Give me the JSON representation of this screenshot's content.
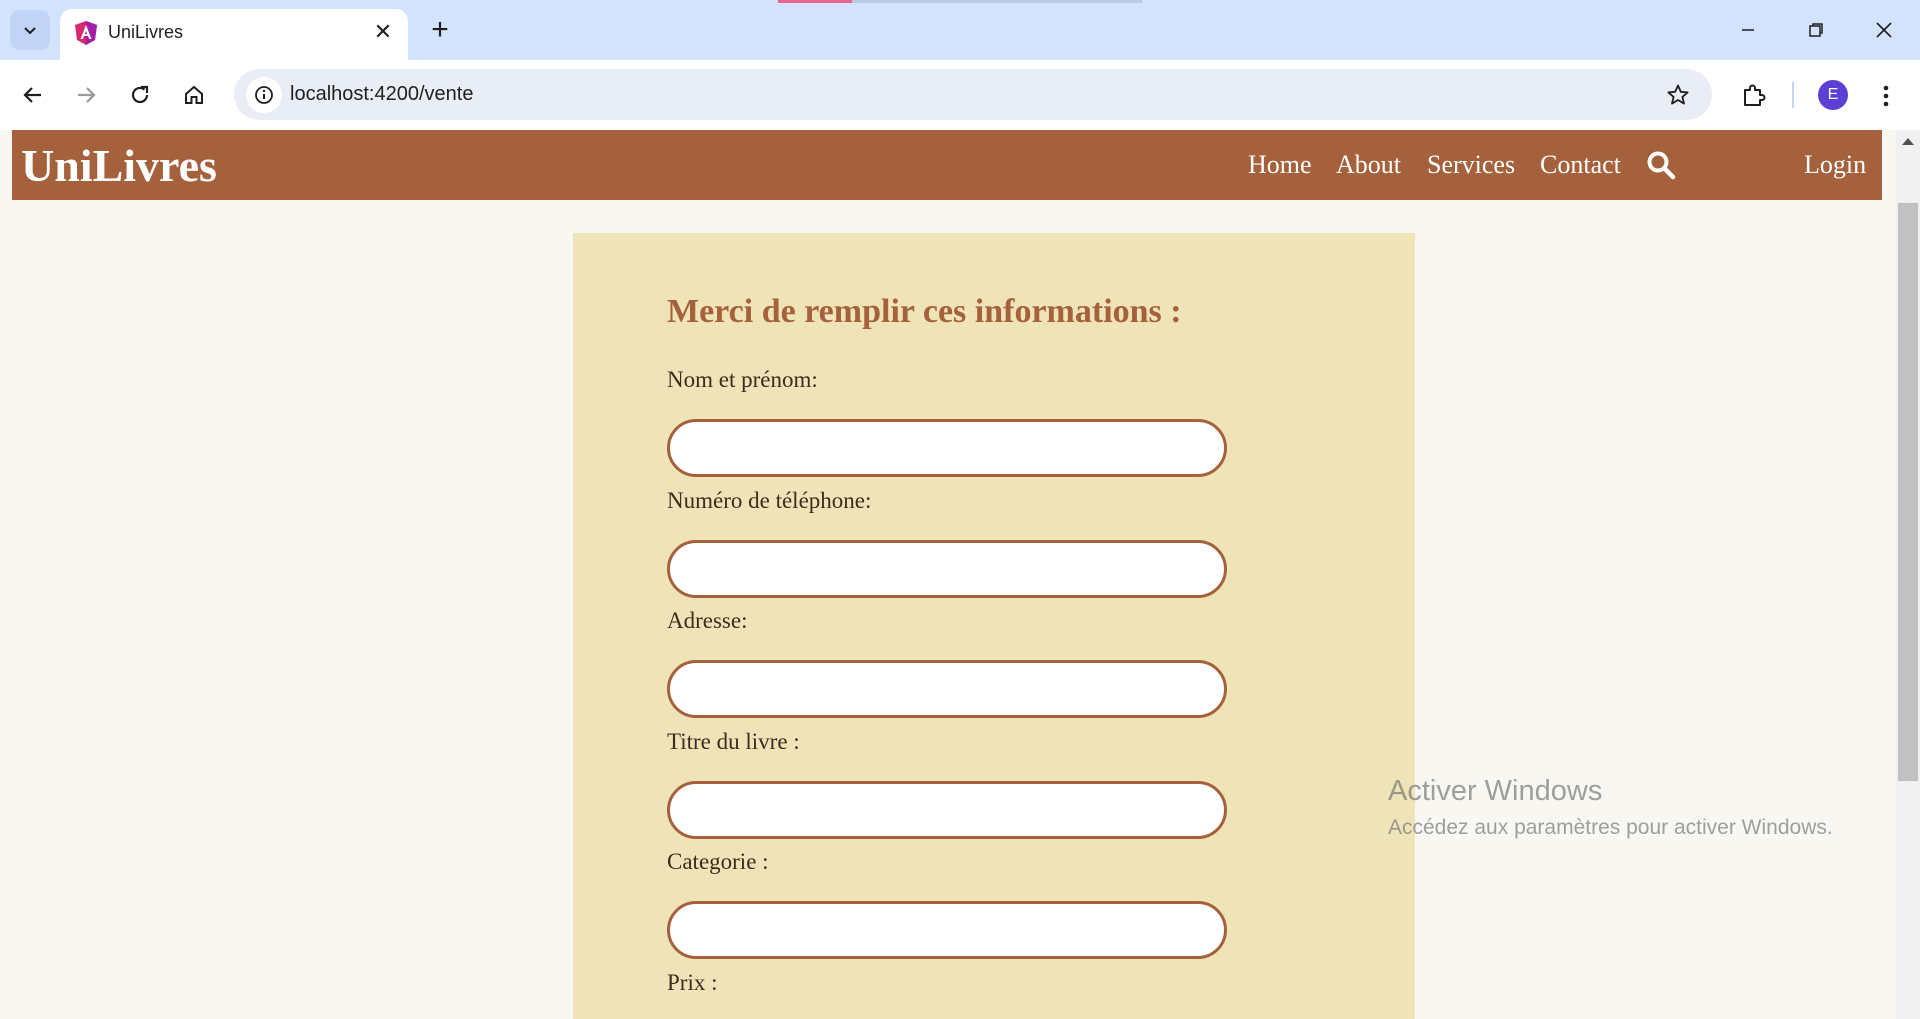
{
  "browser": {
    "tab_title": "UniLivres",
    "url": "localhost:4200/vente",
    "profile_initial": "E",
    "favicon": "angular-logo-icon"
  },
  "site": {
    "brand": "UniLivres",
    "nav": {
      "home": "Home",
      "about": "About",
      "services": "Services",
      "contact": "Contact",
      "login": "Login"
    },
    "colors": {
      "header": "#a5613b",
      "panel": "#efe3b8",
      "page": "#f9f7f1"
    }
  },
  "form": {
    "title": "Merci de remplir ces informations :",
    "fields": [
      {
        "label": "Nom et prénom:",
        "value": ""
      },
      {
        "label": "Numéro de téléphone:",
        "value": ""
      },
      {
        "label": "Adresse:",
        "value": ""
      },
      {
        "label": "Titre du livre :",
        "value": ""
      },
      {
        "label": "Categorie :",
        "value": ""
      },
      {
        "label": "Prix :",
        "value": ""
      }
    ]
  },
  "watermark": {
    "title": "Activer Windows",
    "subtitle": "Accédez aux paramètres pour activer Windows."
  }
}
